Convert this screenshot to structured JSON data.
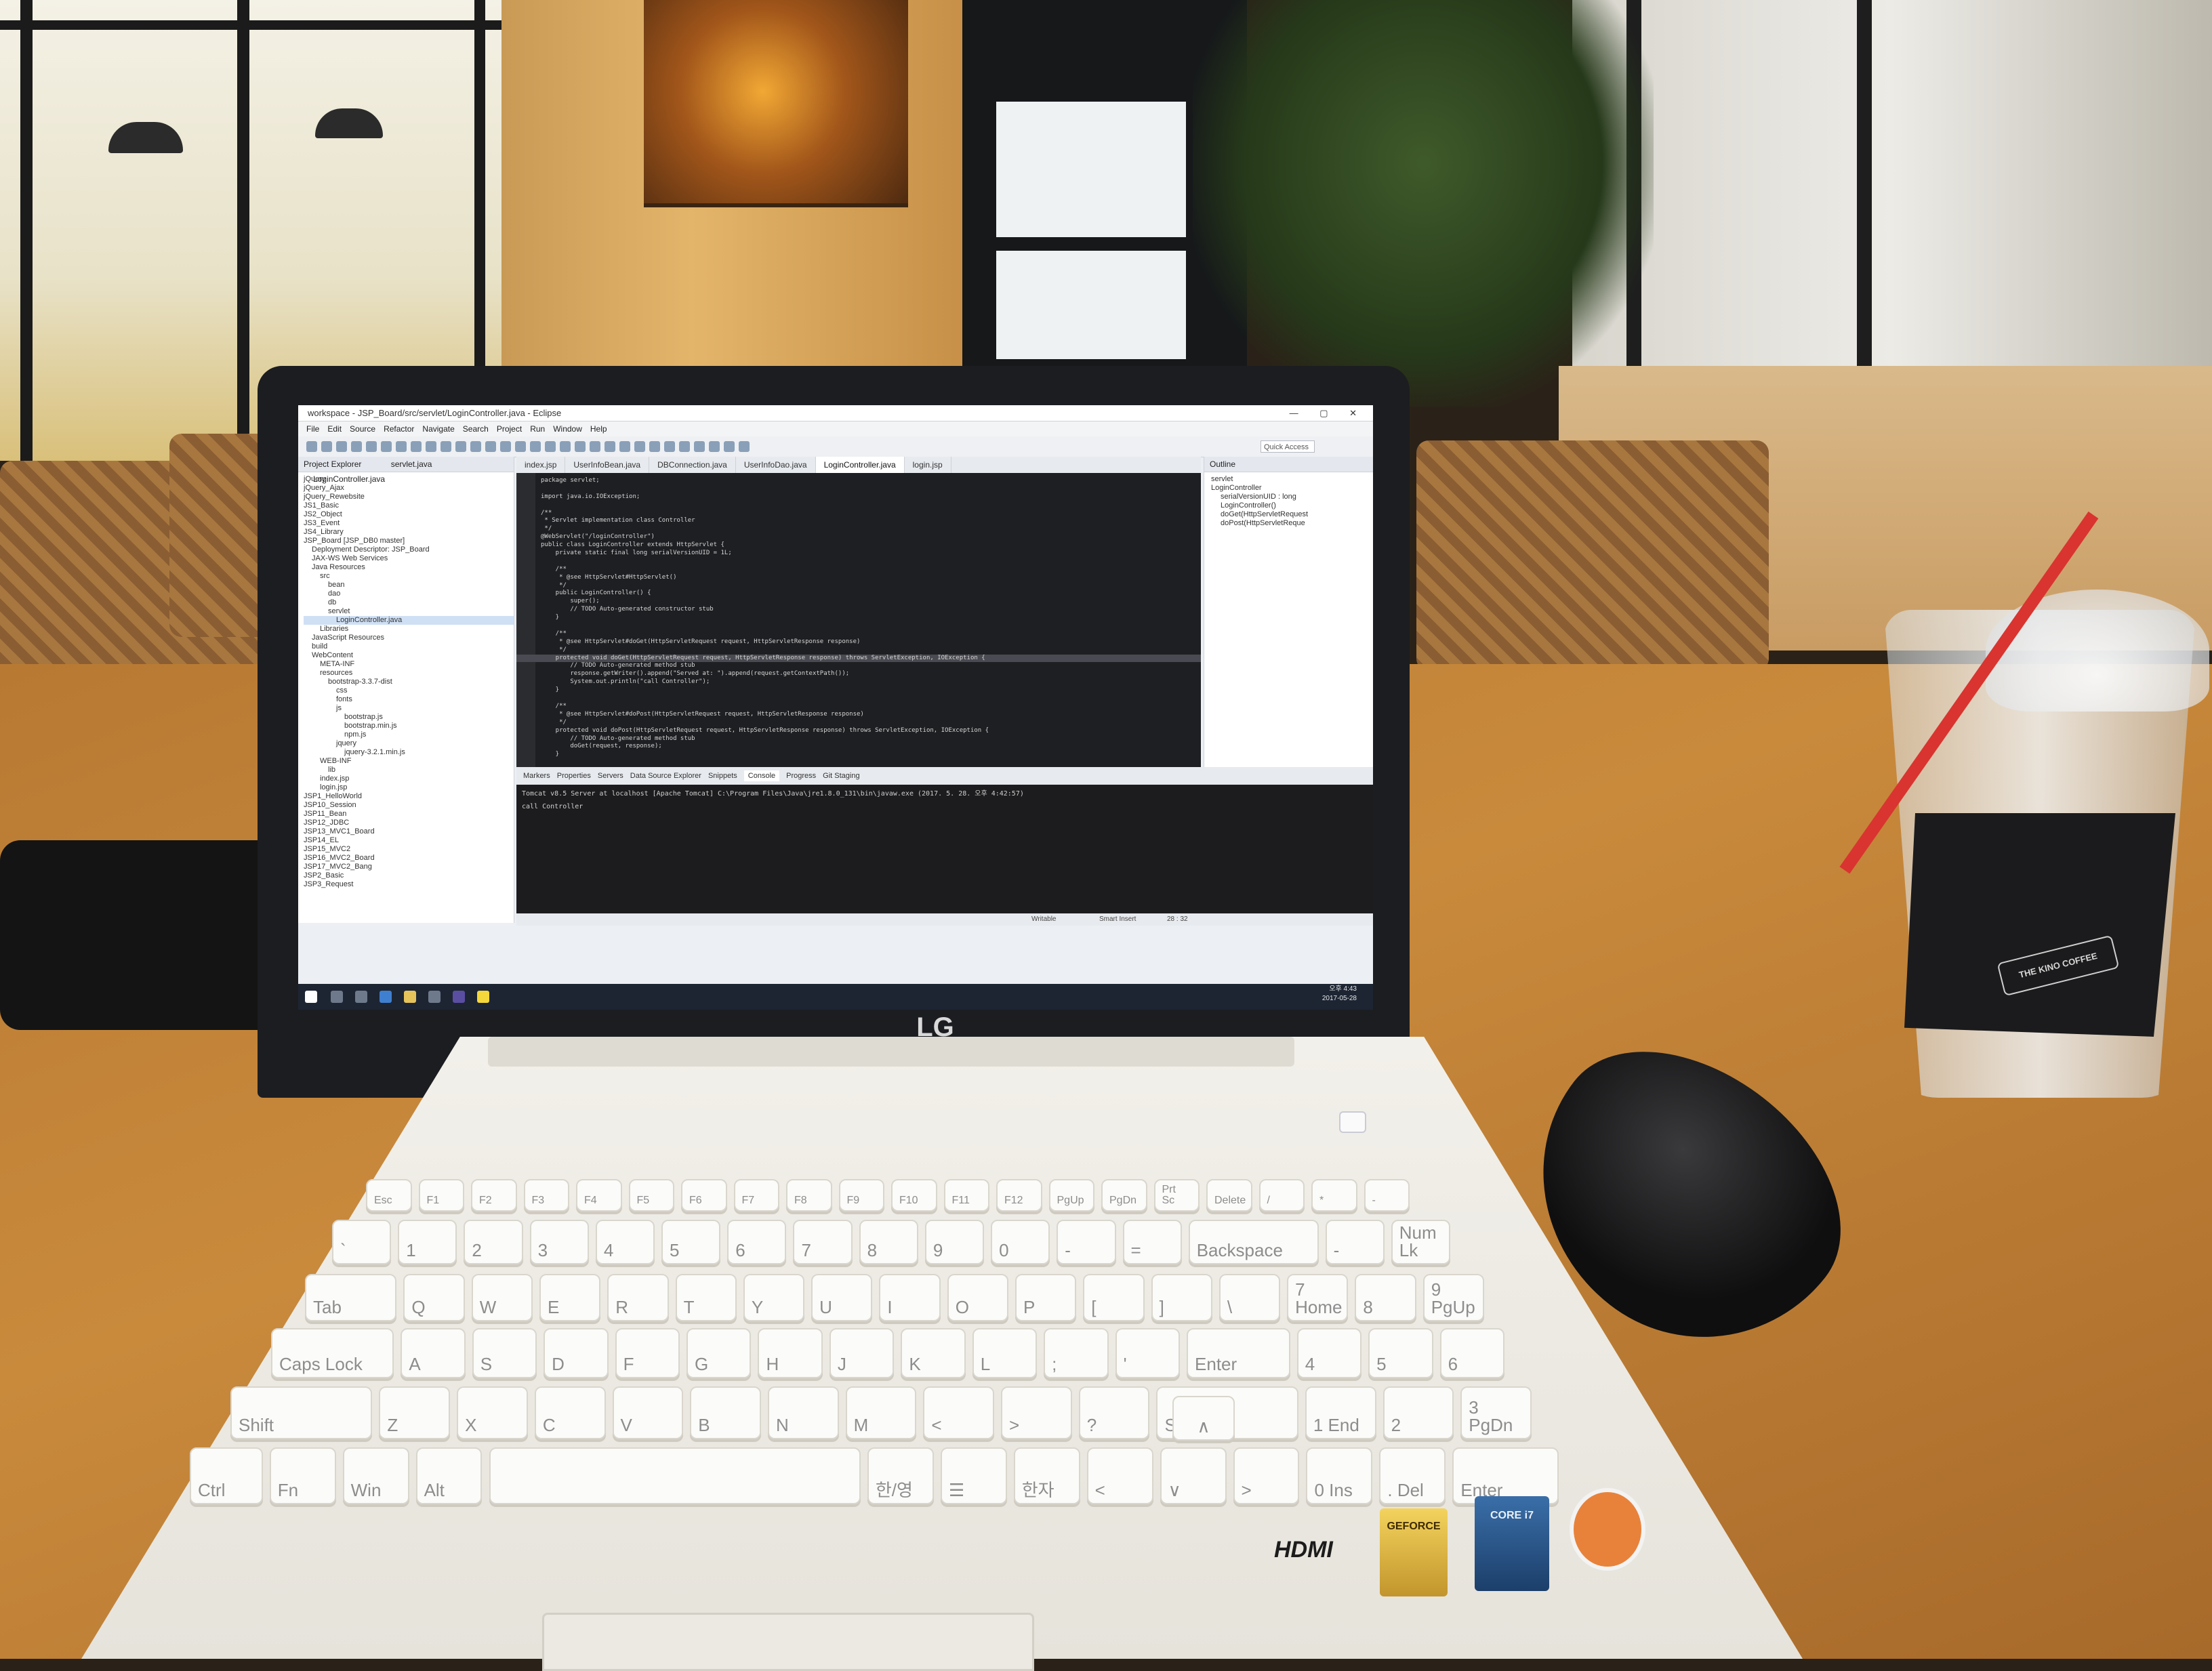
{
  "scene": {
    "laptop_brand": "LG",
    "base_labels": {
      "hdmi": "HDMI",
      "geforce": "GEFORCE",
      "intel": "CORE i7"
    },
    "cup_sleeve_text": "THE KINO COFFEE"
  },
  "eclipse": {
    "window_title": "workspace - JSP_Board/src/servlet/LoginController.java - Eclipse",
    "menu": [
      "File",
      "Edit",
      "Source",
      "Refactor",
      "Navigate",
      "Search",
      "Project",
      "Run",
      "Window",
      "Help"
    ],
    "quick_access": "Quick Access",
    "explorer_title": "Project Explorer",
    "explorer_tabs": [
      "servlet.java",
      "LoginController.java"
    ],
    "tree": [
      "jQuery",
      "jQuery_Ajax",
      "jQuery_Rewebsite",
      "JS1_Basic",
      "JS2_Object",
      "JS3_Event",
      "JS4_Library",
      "JSP_Board [JSP_DB0 master]",
      "Deployment Descriptor: JSP_Board",
      "JAX-WS Web Services",
      "Java Resources",
      "src",
      "bean",
      "dao",
      "db",
      "servlet",
      "LoginController.java",
      "Libraries",
      "JavaScript Resources",
      "build",
      "WebContent",
      "META-INF",
      "resources",
      "bootstrap-3.3.7-dist",
      "css",
      "fonts",
      "js",
      "bootstrap.js",
      "bootstrap.min.js",
      "npm.js",
      "jquery",
      "jquery-3.2.1.min.js",
      "WEB-INF",
      "lib",
      "index.jsp",
      "login.jsp",
      "JSP1_HelloWorld",
      "JSP10_Session",
      "JSP11_Bean",
      "JSP12_JDBC",
      "JSP13_MVC1_Board",
      "JSP14_EL",
      "JSP15_MVC2",
      "JSP16_MVC2_Board",
      "JSP17_MVC2_Bang",
      "JSP2_Basic",
      "JSP3_Request"
    ],
    "editor_tabs": [
      {
        "label": "index.jsp",
        "active": false
      },
      {
        "label": "UserInfoBean.java",
        "active": false
      },
      {
        "label": "DBConnection.java",
        "active": false
      },
      {
        "label": "UserInfoDao.java",
        "active": false
      },
      {
        "label": "LoginController.java",
        "active": true
      },
      {
        "label": "login.jsp",
        "active": false
      }
    ],
    "code": [
      "package servlet;",
      "",
      "import java.io.IOException;",
      "",
      "/**",
      " * Servlet implementation class Controller",
      " */",
      "@WebServlet(\"/loginController\")",
      "public class LoginController extends HttpServlet {",
      "    private static final long serialVersionUID = 1L;",
      "",
      "    /**",
      "     * @see HttpServlet#HttpServlet()",
      "     */",
      "    public LoginController() {",
      "        super();",
      "        // TODO Auto-generated constructor stub",
      "    }",
      "",
      "    /**",
      "     * @see HttpServlet#doGet(HttpServletRequest request, HttpServletResponse response)",
      "     */",
      "    protected void doGet(HttpServletRequest request, HttpServletResponse response) throws ServletException, IOException {",
      "        // TODO Auto-generated method stub",
      "        response.getWriter().append(\"Served at: \").append(request.getContextPath());",
      "        System.out.println(\"call Controller\");",
      "    }",
      "",
      "    /**",
      "     * @see HttpServlet#doPost(HttpServletRequest request, HttpServletResponse response)",
      "     */",
      "    protected void doPost(HttpServletRequest request, HttpServletResponse response) throws ServletException, IOException {",
      "        // TODO Auto-generated method stub",
      "        doGet(request, response);",
      "    }"
    ],
    "highlight_line": 22,
    "outline_title": "Outline",
    "outline": [
      "servlet",
      "LoginController",
      "serialVersionUID : long",
      "LoginController()",
      "doGet(HttpServletRequest",
      "doPost(HttpServletReque"
    ],
    "console_tabs": [
      {
        "label": "Markers",
        "active": false
      },
      {
        "label": "Properties",
        "active": false
      },
      {
        "label": "Servers",
        "active": false
      },
      {
        "label": "Data Source Explorer",
        "active": false
      },
      {
        "label": "Snippets",
        "active": false
      },
      {
        "label": "Console",
        "active": true
      },
      {
        "label": "Progress",
        "active": false
      },
      {
        "label": "Git Staging",
        "active": false
      }
    ],
    "console_header": "Tomcat v8.5 Server at localhost [Apache Tomcat] C:\\Program Files\\Java\\jre1.8.0_131\\bin\\javaw.exe (2017. 5. 28. 오후 4:42:57)",
    "console_output": "call Controller",
    "status": {
      "mode": "Writable",
      "insert": "Smart Insert",
      "position": "28 : 32"
    },
    "clock": {
      "time": "오후 4:43",
      "date": "2017-05-28"
    }
  },
  "keyboard": {
    "rows": [
      [
        "Esc",
        "F1",
        "F2",
        "F3",
        "F4",
        "F5",
        "F6",
        "F7",
        "F8",
        "F9",
        "F10",
        "F11",
        "F12",
        "PgUp",
        "PgDn",
        "Prt Sc",
        "Delete",
        "/",
        "*",
        "-"
      ],
      [
        "`",
        "1",
        "2",
        "3",
        "4",
        "5",
        "6",
        "7",
        "8",
        "9",
        "0",
        "-",
        "=",
        "Backspace",
        "-",
        "Num Lk"
      ],
      [
        "Tab",
        "Q",
        "W",
        "E",
        "R",
        "T",
        "Y",
        "U",
        "I",
        "O",
        "P",
        "[",
        "]",
        "\\",
        "7 Home",
        "8",
        "9 PgUp"
      ],
      [
        "Caps Lock",
        "A",
        "S",
        "D",
        "F",
        "G",
        "H",
        "J",
        "K",
        "L",
        ";",
        "'",
        "Enter",
        "4",
        "5",
        "6"
      ],
      [
        "Shift",
        "Z",
        "X",
        "C",
        "V",
        "B",
        "N",
        "M",
        "<",
        ">",
        "?",
        "Shift",
        "1 End",
        "2",
        "3 PgDn"
      ],
      [
        "Ctrl",
        "Fn",
        "Win",
        "Alt",
        "",
        "한/영",
        "☰",
        "한자",
        "<",
        "∨",
        ">",
        "0 Ins",
        ". Del",
        "Enter"
      ]
    ],
    "up_arrow": "∧"
  }
}
